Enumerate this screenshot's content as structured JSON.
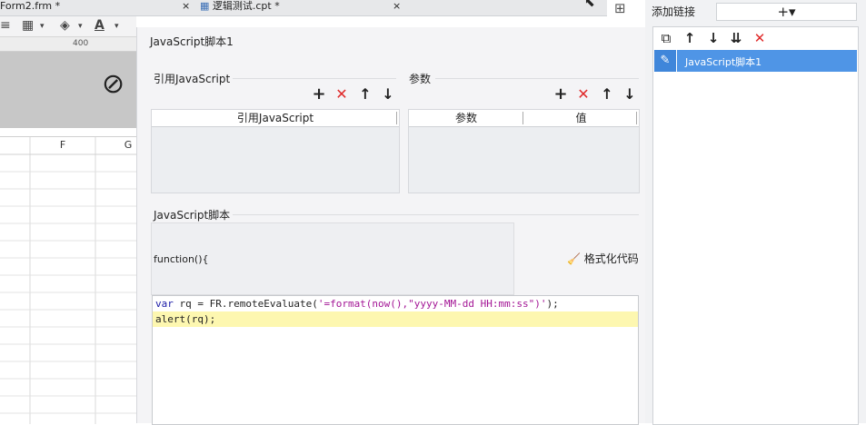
{
  "tabs": [
    {
      "label": "Form2.frm *",
      "close": "×"
    },
    {
      "label": "逻辑测试.cpt *",
      "close": "×"
    }
  ],
  "ruler": {
    "mark": "400"
  },
  "grid": {
    "columns": [
      "F",
      "G"
    ]
  },
  "dialog": {
    "title": "JavaScript脚本1",
    "ref_section": "引用JavaScript",
    "ref_table_header": "引用JavaScript",
    "param_section": "参数",
    "param_headers": [
      "参数",
      "值"
    ],
    "script_section": "JavaScript脚本",
    "function_text": "function(){",
    "format_label": "格式化代码",
    "code_lines": [
      {
        "parts": [
          {
            "t": "var",
            "c": "kw"
          },
          {
            "t": " rq = FR.remoteEvaluate(",
            "c": ""
          },
          {
            "t": "'=format(now(),\"yyyy-MM-dd HH:mm:ss\")'",
            "c": "str"
          },
          {
            "t": ");",
            "c": ""
          }
        ]
      },
      {
        "parts": [
          {
            "t": "alert(rq);",
            "c": ""
          }
        ]
      }
    ]
  },
  "right_panel": {
    "title": "添加链接",
    "add_label": "+▾",
    "list_items": [
      "JavaScript脚本1"
    ]
  },
  "colors": {
    "accent": "#4f95e6",
    "delete": "#e02a2a",
    "highlight": "#fdf7b0"
  },
  "icons": [
    "plus-icon",
    "delete-icon",
    "arrow-up-icon",
    "arrow-down-icon",
    "copy-icon",
    "move-bottom-icon",
    "pencil-icon",
    "broom-icon",
    "eye-off-icon"
  ]
}
